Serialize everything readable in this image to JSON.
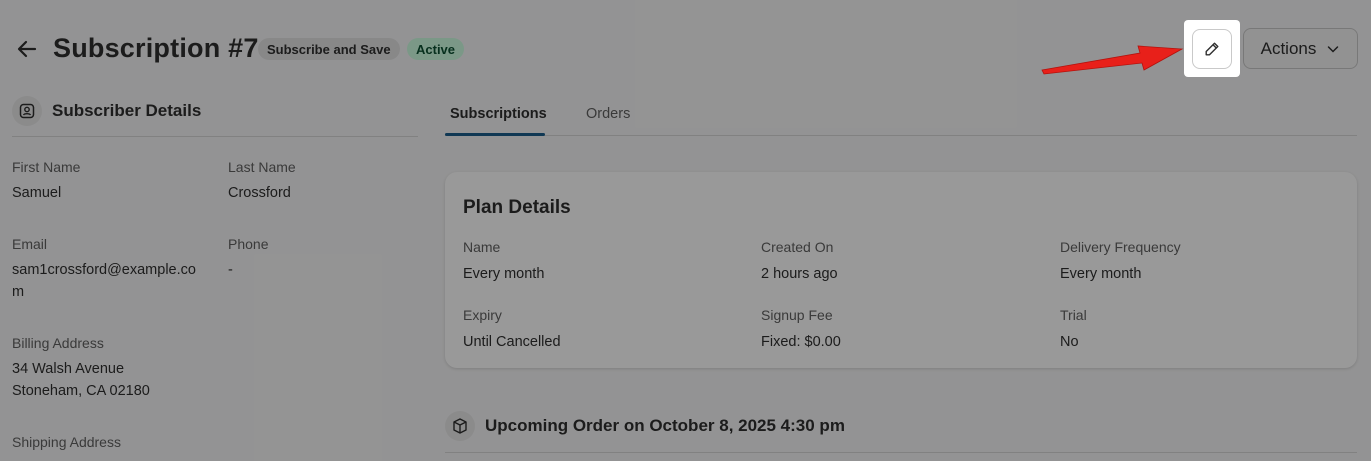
{
  "header": {
    "title": "Subscription #7",
    "plan_badge": "Subscribe and Save",
    "status_badge": "Active",
    "actions_label": "Actions",
    "back_icon": "arrow-left-icon",
    "edit_icon": "pencil-icon",
    "actions_icon": "chevron-down-icon"
  },
  "subscriber": {
    "heading": "Subscriber Details",
    "icon": "user-badge-icon",
    "first_name_label": "First Name",
    "first_name": "Samuel",
    "last_name_label": "Last Name",
    "last_name": "Crossford",
    "email_label": "Email",
    "email_line1": "sam1crossford@example.co",
    "email_line2": "m",
    "phone_label": "Phone",
    "phone": "-",
    "billing_label": "Billing Address",
    "billing_line1": "34 Walsh Avenue",
    "billing_line2": "Stoneham, CA 02180",
    "shipping_label": "Shipping Address"
  },
  "tabs": [
    {
      "label": "Subscriptions",
      "active": true
    },
    {
      "label": "Orders",
      "active": false
    }
  ],
  "plan": {
    "title": "Plan Details",
    "name_label": "Name",
    "name": "Every month",
    "created_label": "Created On",
    "created": "2 hours ago",
    "frequency_label": "Delivery Frequency",
    "frequency": "Every month",
    "expiry_label": "Expiry",
    "expiry": "Until Cancelled",
    "signup_label": "Signup Fee",
    "signup": "Fixed: $0.00",
    "trial_label": "Trial",
    "trial": "No"
  },
  "upcoming": {
    "title": "Upcoming Order on October 8, 2025 4:30 pm",
    "icon": "package-icon"
  },
  "colors": {
    "badge_status_bg": "#cdfee1",
    "badge_status_text": "#0c5132",
    "tab_accent": "#1b5e8c",
    "annotation_arrow": "#e8201a"
  }
}
